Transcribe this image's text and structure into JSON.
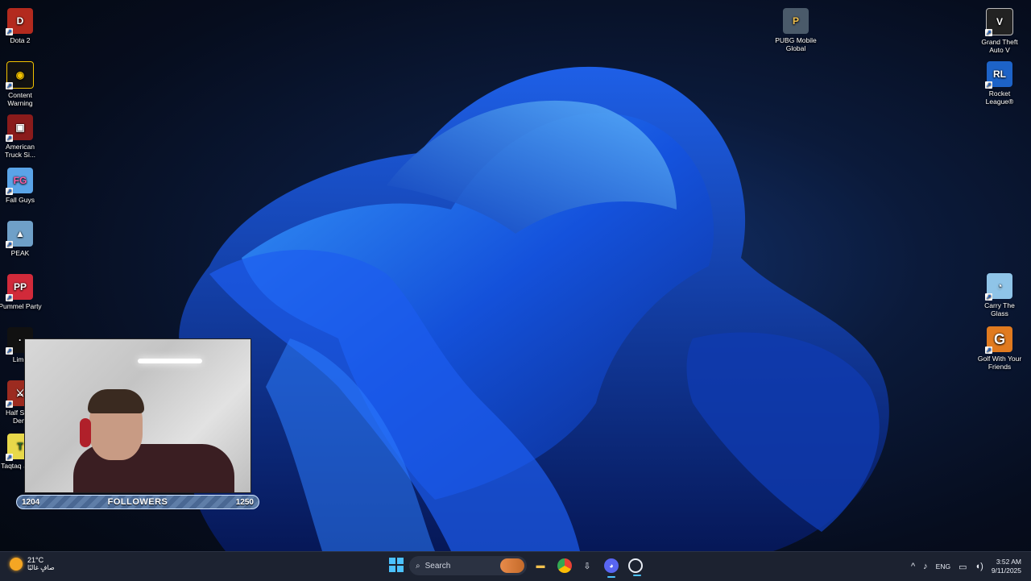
{
  "desktop": {
    "left_icons": [
      {
        "name": "dota2",
        "label": "Dota 2",
        "color": "#b32a1e",
        "glyph": "D"
      },
      {
        "name": "content-warning",
        "label": "Content Warning",
        "color": "#f2c200",
        "glyph": "◉"
      },
      {
        "name": "american-truck",
        "label": "American Truck Si...",
        "color": "#8a1b1b",
        "glyph": "▣"
      },
      {
        "name": "fall-guys",
        "label": "Fall Guys",
        "color": "#5aa4e8",
        "glyph": "FG"
      },
      {
        "name": "peak",
        "label": "PEAK",
        "color": "#6fa0c8",
        "glyph": "▲"
      },
      {
        "name": "pummel-party",
        "label": "Pummel Party",
        "color": "#d12a3a",
        "glyph": "PP"
      },
      {
        "name": "limbo",
        "label": "Limb",
        "color": "#111111",
        "glyph": "·"
      },
      {
        "name": "half-sword",
        "label": "Half Sw... Dem",
        "color": "#9c2b20",
        "glyph": "⚔"
      },
      {
        "name": "taqtaq",
        "label": "Taqtaq قطقة",
        "color": "#e8d84a",
        "glyph": "T"
      }
    ],
    "right_icons": [
      {
        "name": "pubg-mobile",
        "label": "PUBG Mobile Global",
        "color": "#4a5a6a",
        "glyph": "P"
      },
      {
        "name": "gta-v",
        "label": "Grand Theft Auto V",
        "color": "#222222",
        "glyph": "V"
      },
      {
        "name": "rocket-league",
        "label": "Rocket League®",
        "color": "#1d63c8",
        "glyph": "RL"
      },
      {
        "name": "carry-the-glass",
        "label": "Carry The Glass",
        "color": "#8fc4e8",
        "glyph": "◔"
      },
      {
        "name": "golf-with-friends",
        "label": "Golf With Your Friends",
        "color": "#e07a1f",
        "glyph": "G"
      }
    ]
  },
  "overlay": {
    "followers_current": "1204",
    "followers_label": "FOLLOWERS",
    "followers_goal": "1250",
    "progress": 0.963
  },
  "taskbar": {
    "weather": {
      "temp": "21°C",
      "desc": "صافٍ غالبًا"
    },
    "search_label": "Search",
    "apps": [
      {
        "name": "file-explorer",
        "glyph": "▬",
        "color": "#f2c14e"
      },
      {
        "name": "chrome",
        "glyph": "●",
        "color": "#e94235"
      },
      {
        "name": "steam-download",
        "glyph": "⇩",
        "color": "#e8ecf4"
      },
      {
        "name": "discord",
        "glyph": "◕",
        "color": "#5865f2"
      },
      {
        "name": "obs",
        "glyph": "◎",
        "color": "#e8ecf4"
      }
    ],
    "tray": {
      "chevron": "^",
      "mic": "🎙",
      "language": "ENG",
      "network": "▭",
      "volume": "🔊",
      "time": "3:52 AM",
      "date": "9/11/2025"
    }
  }
}
